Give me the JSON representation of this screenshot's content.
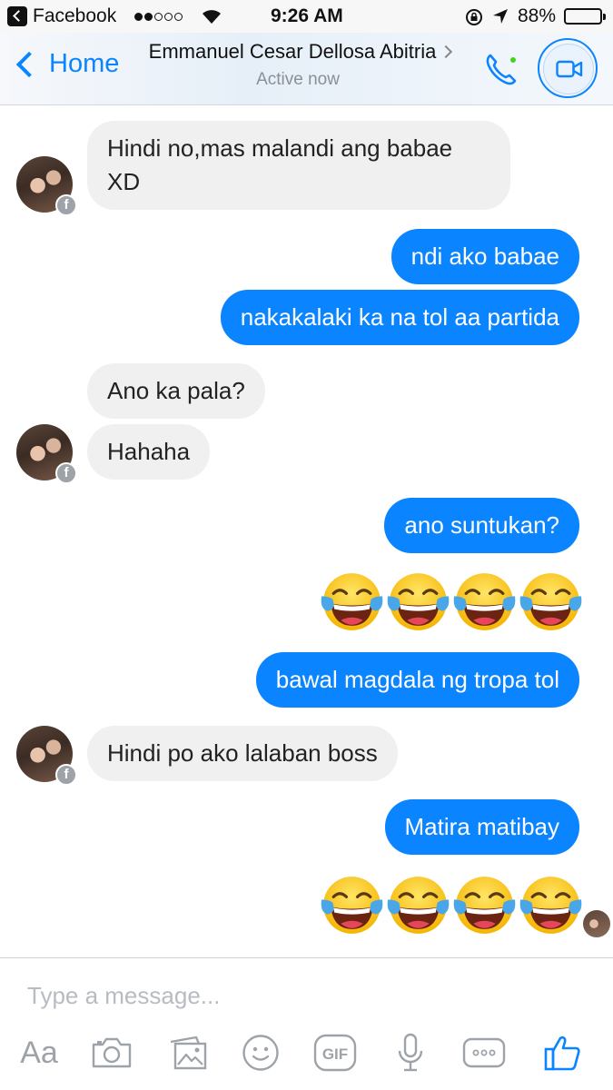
{
  "status_bar": {
    "app_name": "Facebook",
    "time": "9:26 AM",
    "battery_percent": "88%",
    "battery_level": 0.88,
    "signal_bars_filled": 2,
    "signal_bars_total": 5
  },
  "nav": {
    "back_label": "Home",
    "contact_name": "Emmanuel Cesar Dellosa Abitria",
    "status": "Active now"
  },
  "colors": {
    "accent": "#0a84ff",
    "incoming_bubble": "#f1f0f0",
    "online_dot": "#44d21a"
  },
  "messages": [
    {
      "from": "them",
      "text": "Hindi no,mas malandi ang babae",
      "text2": "XD"
    },
    {
      "from": "me",
      "text": "ndi ako babae"
    },
    {
      "from": "me",
      "text": "nakakalaki ka na tol aa partida"
    },
    {
      "from": "them",
      "text": "Ano ka pala?"
    },
    {
      "from": "them",
      "text": "Hahaha"
    },
    {
      "from": "me",
      "text": "ano suntukan?"
    },
    {
      "from": "me",
      "type": "emoji",
      "emoji": "face-with-tears-of-joy",
      "count": 4
    },
    {
      "from": "me",
      "text": "bawal magdala ng tropa tol"
    },
    {
      "from": "them",
      "text": "Hindi po ako lalaban boss"
    },
    {
      "from": "me",
      "text": "Matira matibay"
    },
    {
      "from": "me",
      "type": "emoji",
      "emoji": "face-with-tears-of-joy",
      "count": 4
    }
  ],
  "composer": {
    "placeholder": "Type a message...",
    "text_button": "Aa",
    "gif_label": "GIF",
    "icons": [
      "camera-icon",
      "gallery-icon",
      "emoji-icon",
      "gif-icon",
      "microphone-icon",
      "more-icon",
      "thumbs-up-icon"
    ]
  }
}
